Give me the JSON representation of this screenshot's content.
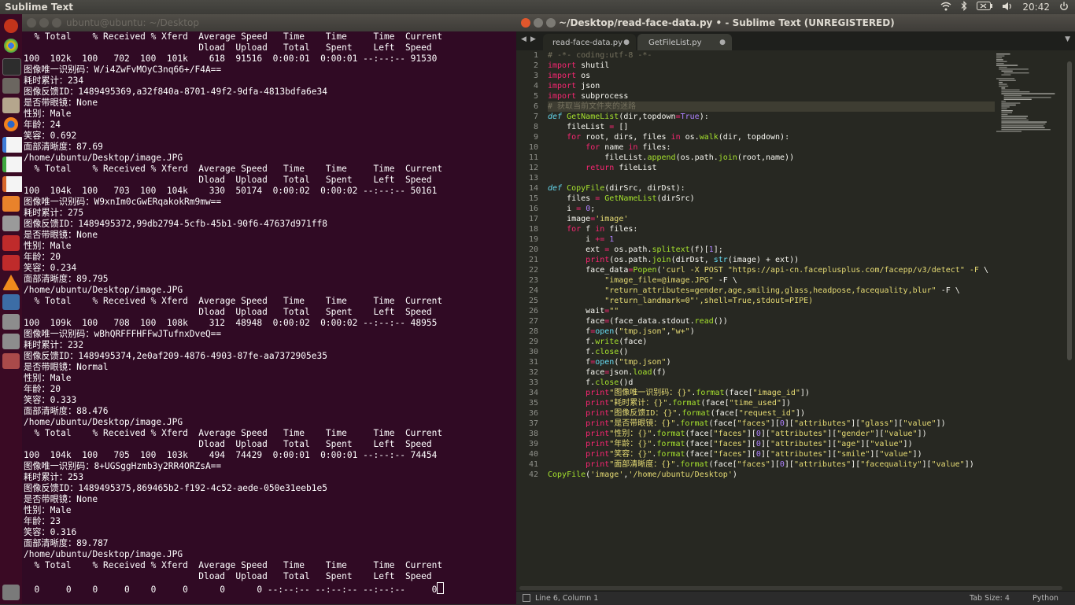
{
  "top_panel": {
    "app_title": "Sublime Text",
    "clock": "20:42",
    "icons": [
      "wifi-icon",
      "bluetooth-icon",
      "battery-icon",
      "volume-icon",
      "power-icon"
    ]
  },
  "launcher": {
    "icons": [
      "ubuntu-dash-icon",
      "chrome-icon",
      "terminal-icon",
      "image-viewer-icon",
      "files-icon",
      "firefox-icon",
      "writer-icon",
      "calc-icon",
      "impress-icon",
      "app-store-icon",
      "settings-icon",
      "filezilla-icon",
      "vlc-icon",
      "sublime-icon",
      "drive-icon",
      "drive-icon",
      "drive-icon",
      "trash-icon"
    ]
  },
  "terminal": {
    "title": "ubuntu@ubuntu: ~/Desktop",
    "lines": [
      "  % Total    % Received % Xferd  Average Speed   Time    Time     Time  Current",
      "                                 Dload  Upload   Total   Spent    Left  Speed",
      "100  102k  100   702  100  101k    618  91516  0:00:01  0:00:01 --:--:-- 91530",
      "图像唯一识别码：W/i4ZwFvMOyC3nq66+/F4A==",
      "耗时累计：234",
      "图像反馈ID：1489495369,a32f840a-8701-49f2-9dfa-4813bdfa6e34",
      "是否带眼镜：None",
      "性别：Male",
      "年龄：24",
      "笑容：0.692",
      "面部清晰度：87.69",
      "/home/ubuntu/Desktop/image.JPG",
      "  % Total    % Received % Xferd  Average Speed   Time    Time     Time  Current",
      "                                 Dload  Upload   Total   Spent    Left  Speed",
      "100  104k  100   703  100  104k    330  50174  0:00:02  0:00:02 --:--:-- 50161",
      "图像唯一识别码：W9xnIm0cGwERqakokRm9mw==",
      "耗时累计：275",
      "图像反馈ID：1489495372,99db2794-5cfb-45b1-90f6-47637d971ff8",
      "是否带眼镜：None",
      "性别：Male",
      "年龄：20",
      "笑容：0.234",
      "面部清晰度：89.795",
      "/home/ubuntu/Desktop/image.JPG",
      "  % Total    % Received % Xferd  Average Speed   Time    Time     Time  Current",
      "                                 Dload  Upload   Total   Spent    Left  Speed",
      "100  109k  100   708  100  108k    312  48948  0:00:02  0:00:02 --:--:-- 48955",
      "图像唯一识别码：wBhQRFFFHFFwJTufnxDveQ==",
      "耗时累计：232",
      "图像反馈ID：1489495374,2e0af209-4876-4903-87fe-aa7372905e35",
      "是否带眼镜：Normal",
      "性别：Male",
      "年龄：20",
      "笑容：0.333",
      "面部清晰度：88.476",
      "/home/ubuntu/Desktop/image.JPG",
      "  % Total    % Received % Xferd  Average Speed   Time    Time     Time  Current",
      "                                 Dload  Upload   Total   Spent    Left  Speed",
      "100  104k  100   705  100  103k    494  74429  0:00:01  0:00:01 --:--:-- 74454",
      "图像唯一识别码：8+UGSggHzmb3y2RR4ORZsA==",
      "耗时累计：253",
      "图像反馈ID：1489495375,869465b2-f192-4c52-aede-050e31eeb1e5",
      "是否带眼镜：None",
      "性别：Male",
      "年龄：23",
      "笑容：0.316",
      "面部清晰度：89.787",
      "/home/ubuntu/Desktop/image.JPG",
      "  % Total    % Received % Xferd  Average Speed   Time    Time     Time  Current",
      "                                 Dload  Upload   Total   Spent    Left  Speed"
    ],
    "last_line": "  0     0    0     0    0     0      0      0 --:--:-- --:--:-- --:--:--     0"
  },
  "sublime": {
    "title": "~/Desktop/read-face-data.py • - Sublime Text (UNREGISTERED)",
    "tabs": [
      {
        "label": "read-face-data.py",
        "active": true
      },
      {
        "label": "GetFileList.py",
        "active": false
      }
    ],
    "code_lines": [
      "# -*- coding:utf-8 -*-",
      "import shutil",
      "import os",
      "import json",
      "import subprocess",
      "# 获取当前文件夹的迷路",
      "def GetNameList(dir,topdown=True):",
      "    fileList = []",
      "    for root, dirs, files in os.walk(dir, topdown):",
      "        for name in files:",
      "            fileList.append(os.path.join(root,name))",
      "        return fileList",
      "",
      "def CopyFile(dirSrc, dirDst):",
      "    files = GetNameList(dirSrc)",
      "    i = 0;",
      "    image='image'",
      "    for f in files:",
      "        i += 1",
      "        ext = os.path.splitext(f)[1];",
      "        print(os.path.join(dirDst, str(image) + ext))",
      "        face_data=Popen('curl -X POST \"https://api-cn.faceplusplus.com/facepp/v3/detect\" -F \\",
      "            \"image_file=@image.JPG\" -F \\",
      "            \"return_attributes=gender,age,smiling,glass,headpose,facequality,blur\" -F \\",
      "            \"return_landmark=0\"',shell=True,stdout=PIPE)",
      "        wait=\"\"",
      "        face=(face_data.stdout.read())",
      "        f=open(\"tmp.json\",\"w+\")",
      "        f.write(face)",
      "        f.close()",
      "        f=open(\"tmp.json\")",
      "        face=json.load(f)",
      "        f.close()d",
      "        print\"图像唯一识别码：{}\".format(face[\"image_id\"])",
      "        print\"耗时累计：{}\".format(face[\"time_used\"])",
      "        print\"图像反馈ID：{}\".format(face[\"request_id\"])",
      "        print\"是否带眼镜：{}\".format(face[\"faces\"][0][\"attributes\"][\"glass\"][\"value\"])",
      "        print\"性别：{}\".format(face[\"faces\"][0][\"attributes\"][\"gender\"][\"value\"])",
      "        print\"年龄：{}\".format(face[\"faces\"][0][\"attributes\"][\"age\"][\"value\"])",
      "        print\"笑容：{}\".format(face[\"faces\"][0][\"attributes\"][\"smile\"][\"value\"])",
      "        print\"面部清晰度：{}\".format(face[\"faces\"][0][\"attributes\"][\"facequality\"][\"value\"])",
      "CopyFile('image','/home/ubuntu/Desktop')"
    ],
    "highlight_line": 6,
    "status": {
      "position": "Line 6, Column 1",
      "tab_size": "Tab Size: 4",
      "syntax": "Python"
    }
  }
}
